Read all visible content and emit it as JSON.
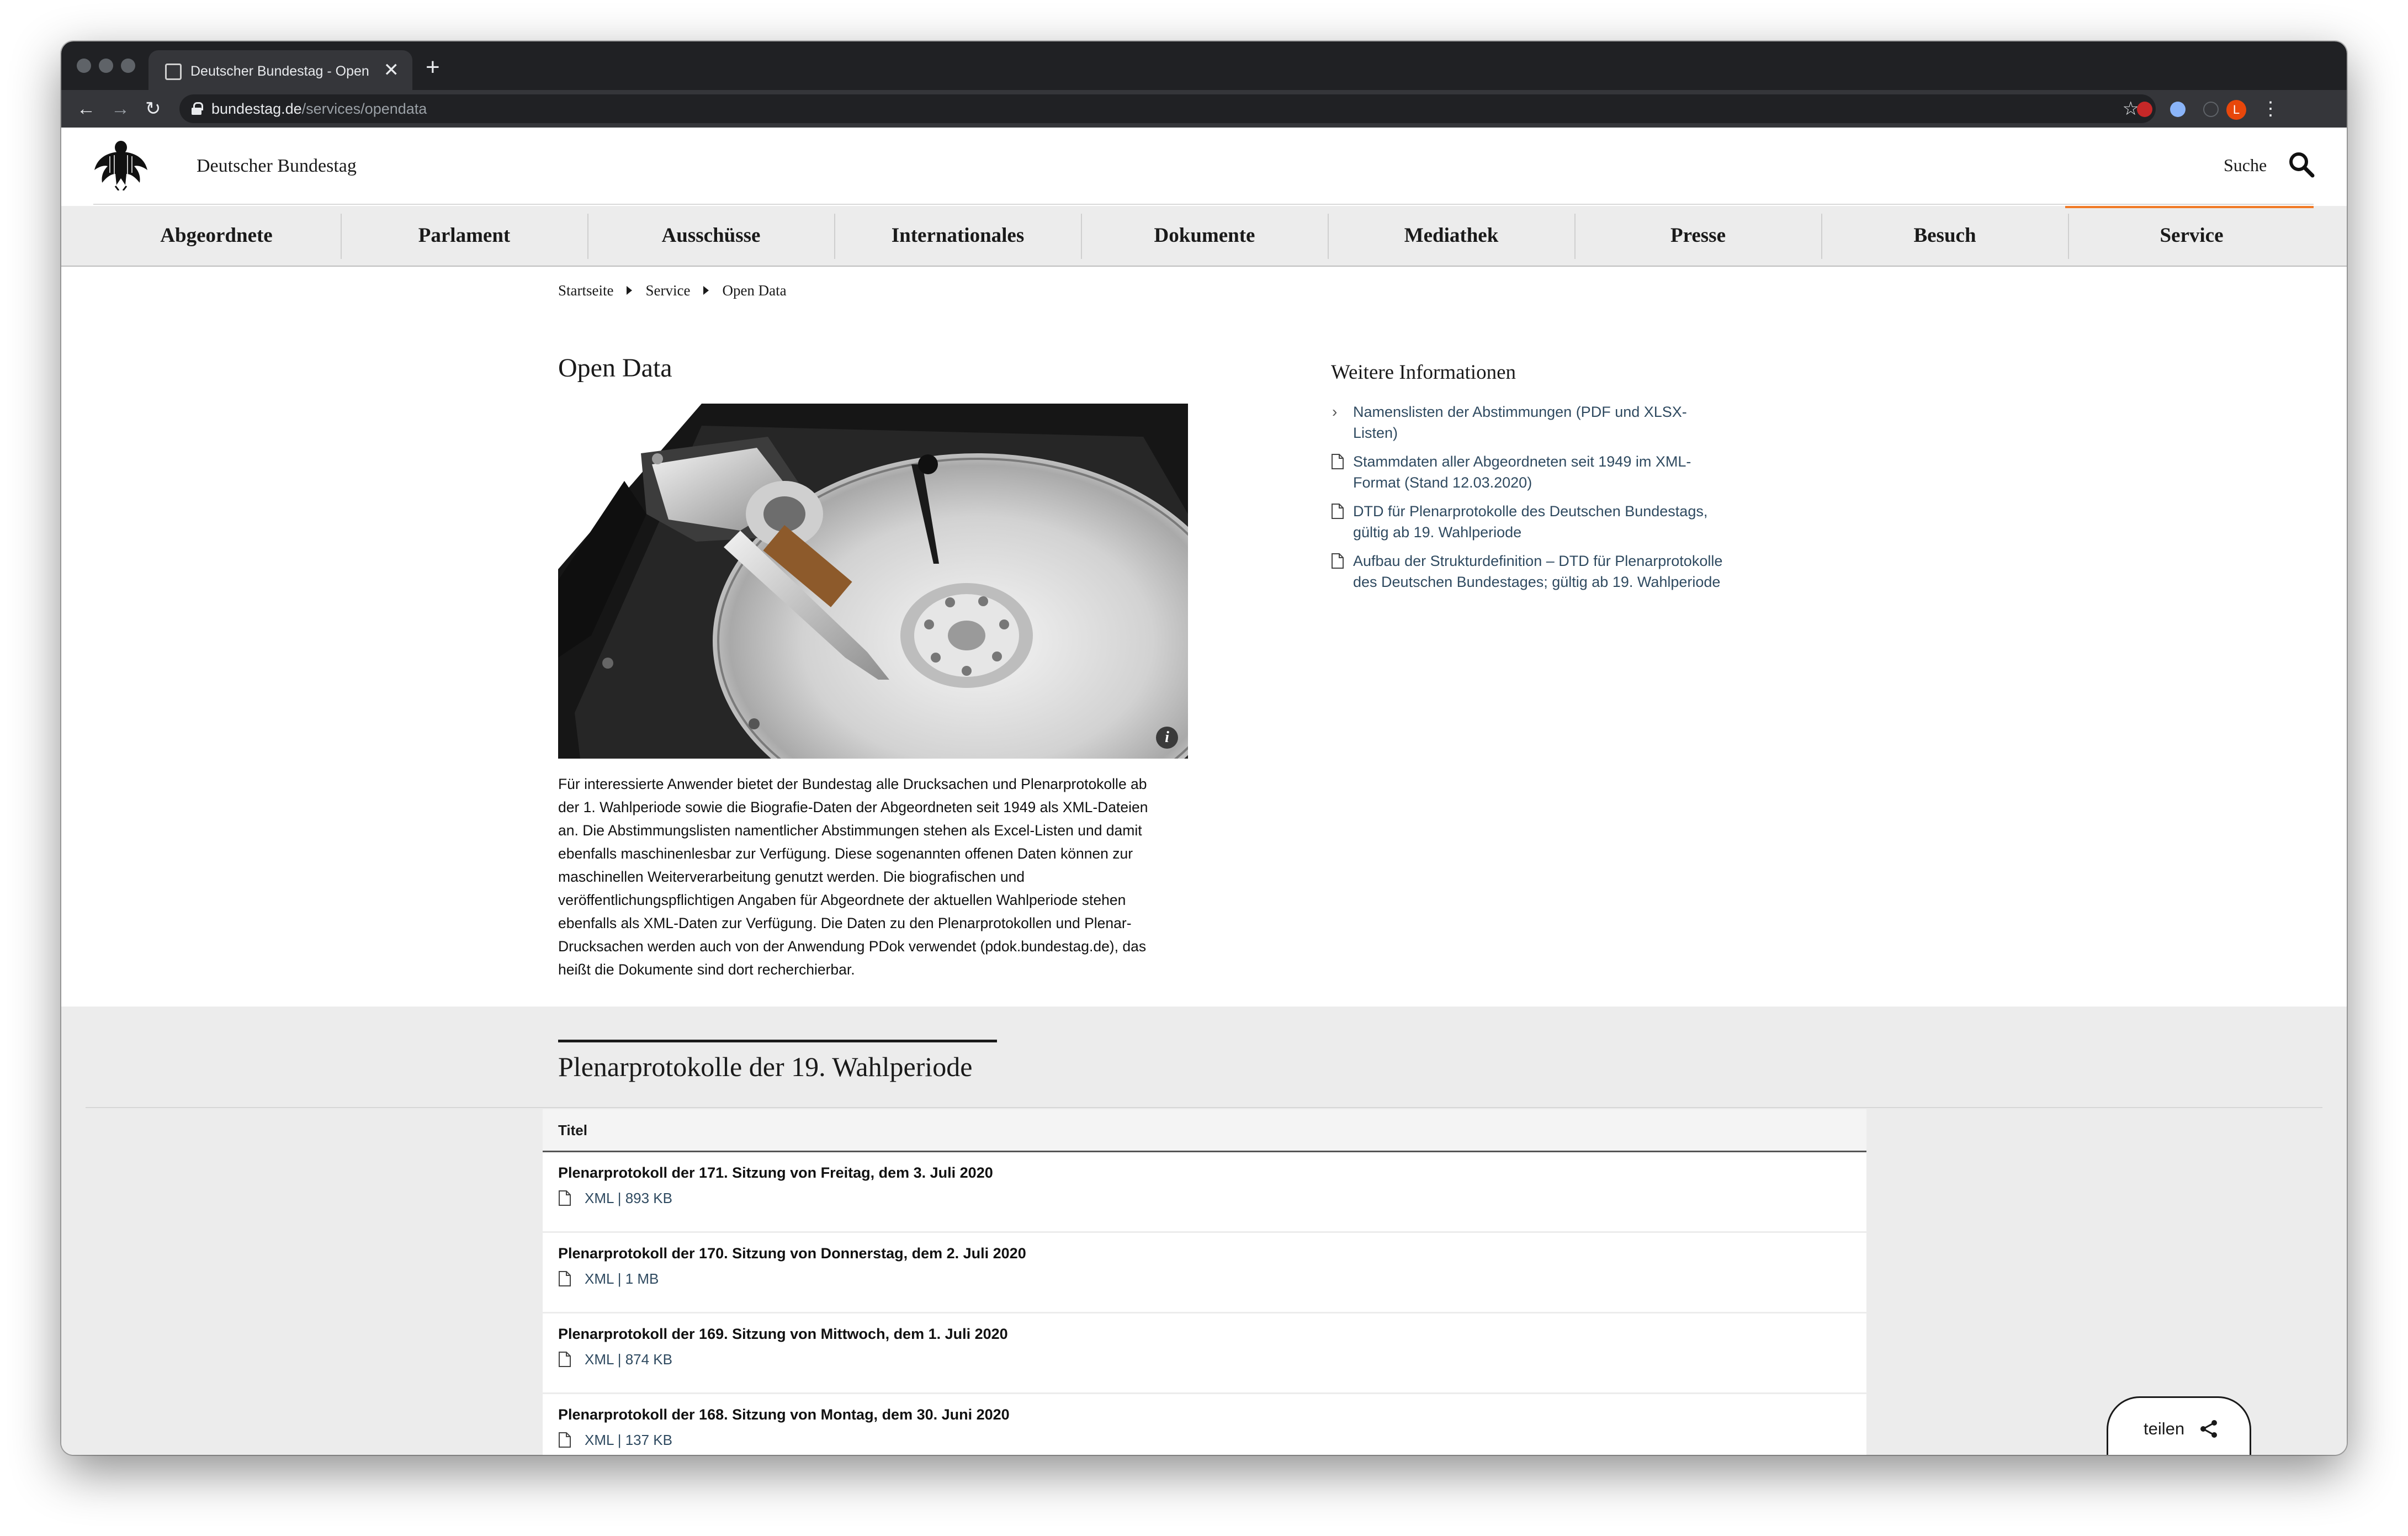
{
  "browser": {
    "tab_title": "Deutscher Bundestag - Open D",
    "new_tab": "+",
    "close": "✕",
    "url_host": "bundestag.de",
    "url_path": "/services/opendata",
    "profile_initial": "L"
  },
  "header": {
    "site_name": "Deutscher Bundestag",
    "search_label": "Suche"
  },
  "nav": [
    "Abgeordnete",
    "Parlament",
    "Ausschüsse",
    "Internationales",
    "Dokumente",
    "Mediathek",
    "Presse",
    "Besuch",
    "Service"
  ],
  "nav_active": "Service",
  "breadcrumb": [
    "Startseite",
    "Service",
    "Open Data"
  ],
  "page": {
    "title": "Open Data",
    "intro_lines": [
      "Für interessierte Anwender bietet der Bundestag alle Drucksachen und Plenarprotokolle ab",
      "der 1. Wahlperiode sowie die Biografie-Daten der Abgeordneten seit 1949 als XML-Dateien",
      "an. Die Abstimmungslisten namentlicher Abstimmungen stehen als Excel-Listen und damit",
      "ebenfalls maschinenlesbar zur Verfügung. Diese sogenannten offenen Daten können zur",
      "maschinellen Weiterverarbeitung genutzt werden. Die biografischen und",
      "veröffentlichungspflichtigen Angaben für Abgeordnete der aktuellen Wahlperiode stehen",
      "ebenfalls als XML-Daten zur Verfügung. Die Daten zu den Plenarprotokollen und Plenar-",
      "Drucksachen werden auch von der Anwendung PDok verwendet (pdok.bundestag.de), das",
      "heißt die Dokumente sind dort recherchierbar."
    ]
  },
  "sidebar": {
    "title": "Weitere Informationen",
    "items": [
      {
        "icon": "chevron-right-icon",
        "lines": [
          "Namenslisten der Abstimmungen (PDF und XLSX-",
          "Listen)"
        ]
      },
      {
        "icon": "document-icon",
        "lines": [
          "Stammdaten aller Abgeordneten seit 1949 im XML-",
          "Format (Stand 12.03.2020)"
        ]
      },
      {
        "icon": "document-icon",
        "lines": [
          "DTD für Plenarprotokolle des Deutschen Bundestags,",
          "gültig ab 19. Wahlperiode"
        ]
      },
      {
        "icon": "document-icon",
        "lines": [
          "Aufbau der Strukturdefinition – DTD für Plenarprotokolle",
          "des Deutschen Bundestages; gültig ab 19. Wahlperiode"
        ]
      }
    ]
  },
  "section": {
    "title": "Plenarprotokolle der 19. Wahlperiode",
    "table_header": "Titel",
    "rows": [
      {
        "title": "Plenarprotokoll der 171. Sitzung von Freitag, dem 3. Juli 2020",
        "file": "XML | 893 KB"
      },
      {
        "title": "Plenarprotokoll der 170. Sitzung von Donnerstag, dem 2. Juli 2020",
        "file": "XML | 1 MB"
      },
      {
        "title": "Plenarprotokoll der 169. Sitzung von Mittwoch, dem 1. Juli 2020",
        "file": "XML | 874 KB"
      },
      {
        "title": "Plenarprotokoll der 168. Sitzung von Montag, dem 30. Juni 2020",
        "file": "XML | 137 KB"
      }
    ]
  },
  "share": {
    "label": "teilen"
  },
  "colors": {
    "accent": "#f07a26",
    "link": "#2f4a60",
    "chrome_dark": "#202124",
    "section_gray": "#ececec"
  }
}
